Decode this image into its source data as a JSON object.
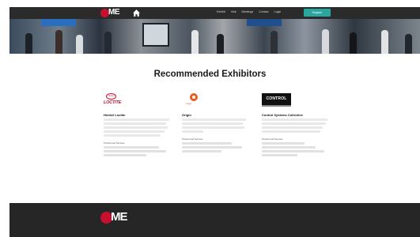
{
  "header": {
    "logo_text": "ME",
    "home_icon": "home-icon",
    "event_dates": "",
    "nav": [
      "Exhibit",
      "Visit",
      "Meetings",
      "Contact",
      "Login"
    ],
    "cta_label": "Register",
    "cta_color": "#2aa6a0"
  },
  "hero": {
    "alt_icon": "exhibition-photo-strip"
  },
  "main": {
    "title": "Recommended Exhibitors",
    "exhibitors": [
      {
        "name": "Henkel Loctite",
        "logo_text": "LOCTITE",
        "logo_ring": "Henkel",
        "products_label": "Product and Services"
      },
      {
        "name": "Origin",
        "logo_text": "origin",
        "products_label": "Product and Services"
      },
      {
        "name": "Control Systems Collective",
        "logo_text": "CONTROL",
        "products_label": "Product and Services"
      }
    ]
  },
  "footer": {
    "logo_text": "ME"
  },
  "colors": {
    "brand_red": "#c8102e",
    "nav_bg": "#2b2b2b",
    "footer_bg": "#262626"
  }
}
